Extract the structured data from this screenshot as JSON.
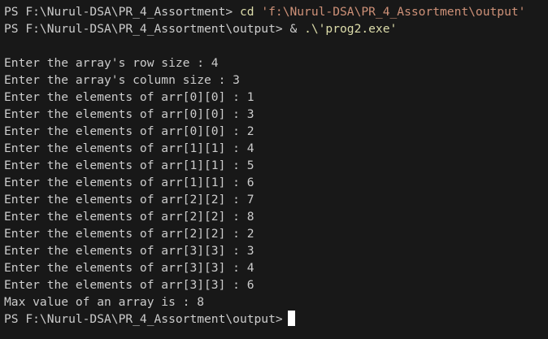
{
  "terminal": {
    "cmd_line_1": {
      "prompt": "PS F:\\Nurul-DSA\\PR_4_Assortment>",
      "command": "cd",
      "argument": "'f:\\Nurul-DSA\\PR_4_Assortment\\output'"
    },
    "cmd_line_2": {
      "prompt": "PS F:\\Nurul-DSA\\PR_4_Assortment\\output>",
      "operator": "&",
      "argument": ".\\'prog2.exe'"
    },
    "output_lines": [
      "Enter the array's row size : 4",
      "Enter the array's column size : 3",
      "Enter the elements of arr[0][0] : 1",
      "Enter the elements of arr[0][0] : 3",
      "Enter the elements of arr[0][0] : 2",
      "Enter the elements of arr[1][1] : 4",
      "Enter the elements of arr[1][1] : 5",
      "Enter the elements of arr[1][1] : 6",
      "Enter the elements of arr[2][2] : 7",
      "Enter the elements of arr[2][2] : 8",
      "Enter the elements of arr[2][2] : 2",
      "Enter the elements of arr[3][3] : 3",
      "Enter the elements of arr[3][3] : 4",
      "Enter the elements of arr[3][3] : 6",
      "Max value of an array is : 8"
    ],
    "final_prompt": "PS F:\\Nurul-DSA\\PR_4_Assortment\\output>"
  },
  "colors": {
    "background": "#181818",
    "text": "#cccccc",
    "command": "#dcdcaa",
    "string": "#ce9178",
    "cursor": "#ffffff"
  }
}
